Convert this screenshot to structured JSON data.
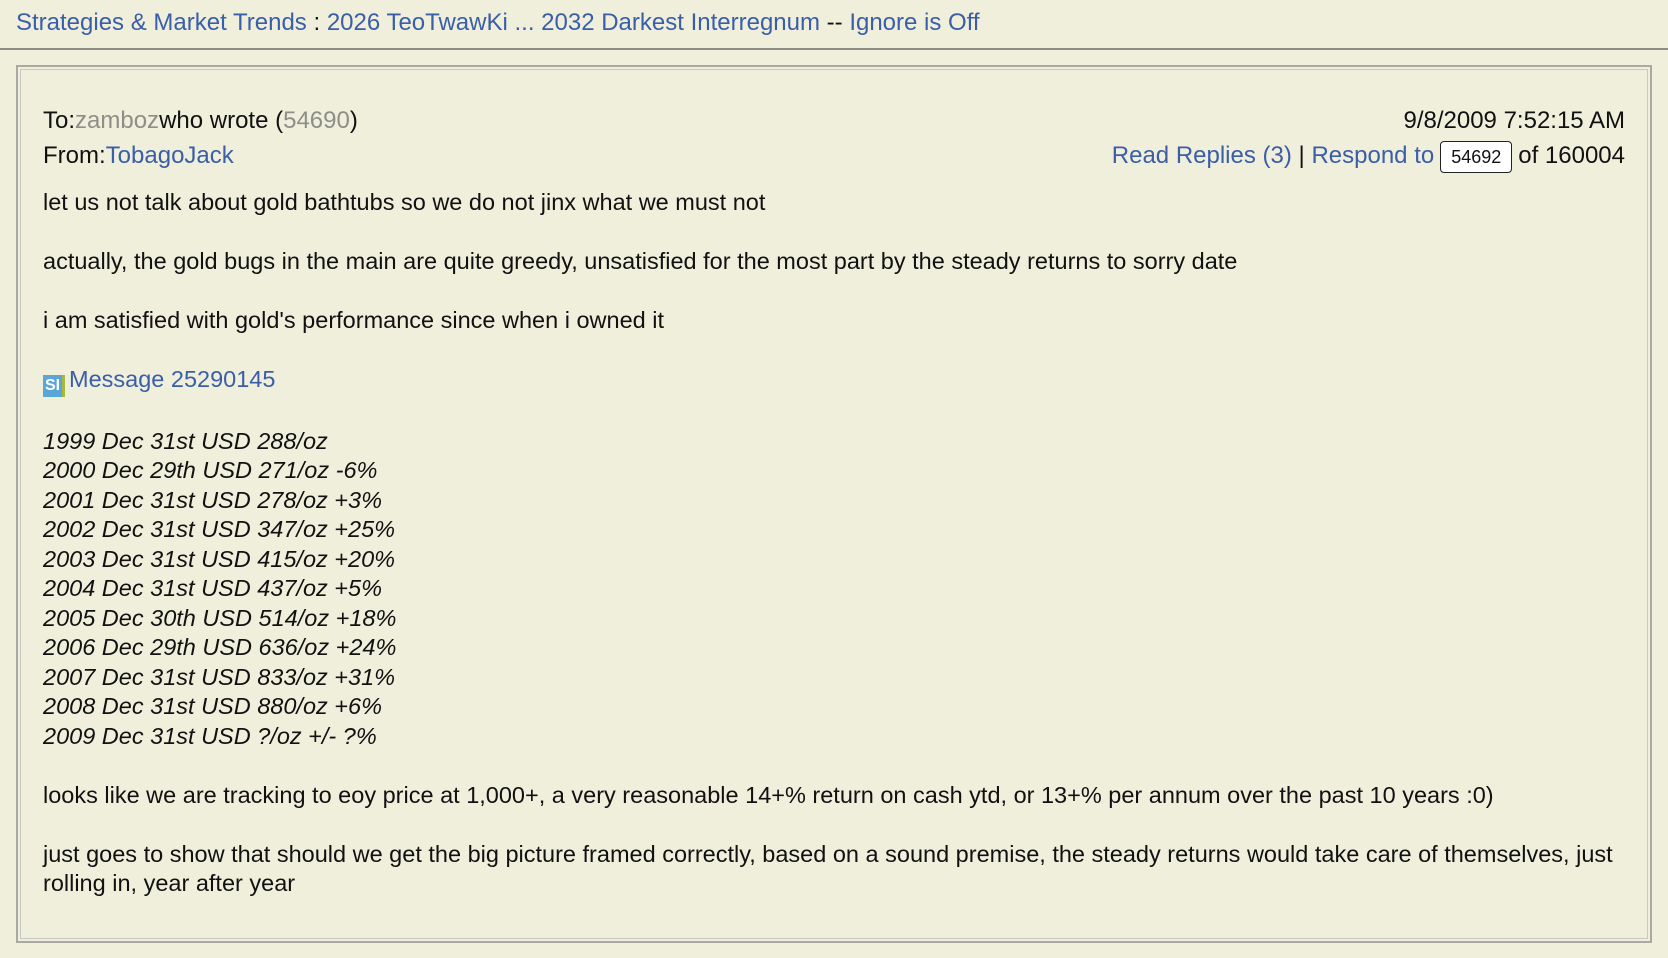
{
  "breadcrumb": {
    "board": "Strategies & Market Trends",
    "separator1": " : ",
    "thread": "2026 TeoTwawKi ... 2032 Darkest Interregnum",
    "separator2": " -- ",
    "ignore": "Ignore is Off"
  },
  "header": {
    "to_label": "To:",
    "to_user": "zamboz",
    "wrote_prefix": "who wrote (",
    "wrote_id": "54690",
    "wrote_suffix": ")",
    "from_label": "From:",
    "from_user": "TobagoJack",
    "timestamp": "9/8/2009 7:52:15 AM",
    "read_replies": "Read Replies (3)",
    "pipe": "|",
    "respond_to": "Respond to",
    "msg_number": "54692",
    "of_total": "of 160004"
  },
  "message": {
    "p1": "let us not talk about gold bathtubs so we do not jinx what we must not",
    "p2": "actually, the gold bugs in the main are quite greedy, unsatisfied for the most part by the steady returns to sorry date",
    "p3": "i am satisfied with gold's performance since when i owned it",
    "link_icon": "SI",
    "link": "Message 25290145",
    "history": [
      "1999 Dec 31st USD 288/oz",
      "2000 Dec 29th USD 271/oz -6%",
      "2001 Dec 31st USD 278/oz +3%",
      "2002 Dec 31st USD 347/oz +25%",
      "2003 Dec 31st USD 415/oz +20%",
      "2004 Dec 31st USD 437/oz +5%",
      "2005 Dec 30th USD 514/oz +18%",
      "2006 Dec 29th USD 636/oz +24%",
      "2007 Dec 31st USD 833/oz +31%",
      "2008 Dec 31st USD 880/oz +6%",
      "2009 Dec 31st USD ?/oz +/- ?%"
    ],
    "p4": "looks like we are tracking to eoy price at 1,000+, a very reasonable 14+% return on cash ytd, or 13+% per annum over the past 10 years :0)",
    "p5": "just goes to show that should we get the big picture framed correctly, based on a sound premise, the steady returns would take care of themselves, just rolling in, year after year"
  },
  "colors": {
    "background": "#efefdc",
    "link": "#3a5ea8",
    "muted": "#8e8e88"
  }
}
